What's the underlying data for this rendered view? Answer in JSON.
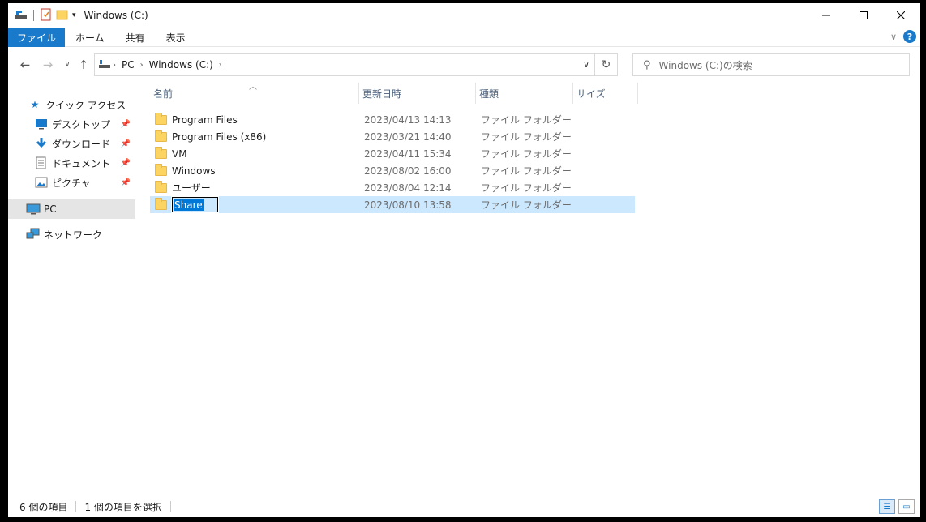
{
  "window": {
    "title": "Windows (C:)"
  },
  "ribbon": {
    "tabs": [
      {
        "label": "ファイル"
      },
      {
        "label": "ホーム"
      },
      {
        "label": "共有"
      },
      {
        "label": "表示"
      }
    ]
  },
  "address": {
    "crumbs": [
      "PC",
      "Windows (C:)"
    ]
  },
  "search": {
    "placeholder": "Windows (C:)の検索"
  },
  "nav": {
    "quick_access": "クイック アクセス",
    "items": [
      {
        "label": "デスクトップ",
        "icon": "desktop-icon"
      },
      {
        "label": "ダウンロード",
        "icon": "download-icon"
      },
      {
        "label": "ドキュメント",
        "icon": "document-icon"
      },
      {
        "label": "ピクチャ",
        "icon": "pictures-icon"
      }
    ],
    "pc": "PC",
    "network": "ネットワーク"
  },
  "columns": {
    "name": "名前",
    "date": "更新日時",
    "type": "種類",
    "size": "サイズ"
  },
  "files": [
    {
      "name": "Program Files",
      "date": "2023/04/13 14:13",
      "type": "ファイル フォルダー"
    },
    {
      "name": "Program Files (x86)",
      "date": "2023/03/21 14:40",
      "type": "ファイル フォルダー"
    },
    {
      "name": "VM",
      "date": "2023/04/11 15:34",
      "type": "ファイル フォルダー"
    },
    {
      "name": "Windows",
      "date": "2023/08/02 16:00",
      "type": "ファイル フォルダー"
    },
    {
      "name": "ユーザー",
      "date": "2023/08/04 12:14",
      "type": "ファイル フォルダー"
    },
    {
      "name": "Share",
      "date": "2023/08/10 13:58",
      "type": "ファイル フォルダー",
      "selected": true,
      "renaming": true
    }
  ],
  "status": {
    "count": "6 個の項目",
    "selected": "1 個の項目を選択"
  },
  "colors": {
    "accent": "#1979ca",
    "selection": "#cce8ff",
    "folder": "#fcd462"
  }
}
